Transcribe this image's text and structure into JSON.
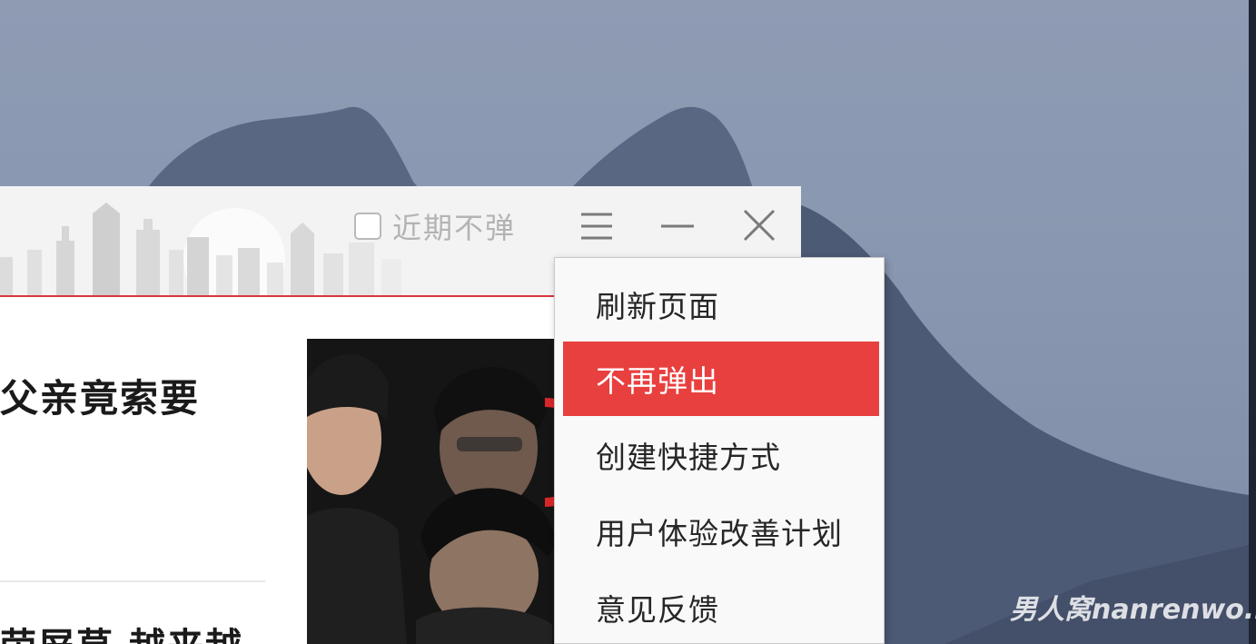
{
  "popup": {
    "dont_show_recently_label": "近期不弹",
    "dont_show_recently_checked": false,
    "menu_icon": "hamburger-icon",
    "minimize_icon": "minimize-icon",
    "close_icon": "close-icon",
    "accent_color": "#d9363e"
  },
  "content": {
    "headline_partial": "父亲竟索要",
    "headline2_partial": "荧屏草 越来越"
  },
  "context_menu": {
    "items": [
      {
        "label": "刷新页面",
        "active": false
      },
      {
        "label": "不再弹出",
        "active": true
      },
      {
        "label": "创建快捷方式",
        "active": false
      },
      {
        "label": "用户体验改善计划",
        "active": false
      },
      {
        "label": "意见反馈",
        "active": false
      }
    ],
    "highlight_color": "#e8403f"
  },
  "watermark": {
    "text": "男人窝nanrenwo.net"
  }
}
